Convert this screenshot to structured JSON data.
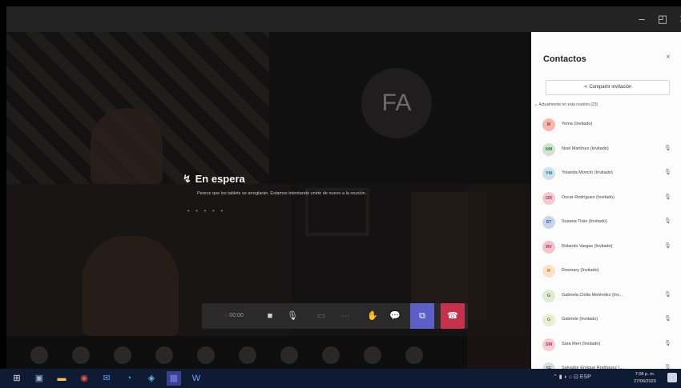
{
  "window": {
    "controls": {
      "minimize": "–",
      "restore": "◰",
      "close": "✕"
    }
  },
  "stage": {
    "avatar_initials": "FA",
    "waiting": {
      "title": "En espera",
      "icon": "waiting-icon",
      "message": "Parece que los tablets se arreglarán. Estamos intentando unirte de nuevo a la reunión.",
      "dots": "• • • • •"
    }
  },
  "controls": {
    "timer": "00:00",
    "buttons": [
      {
        "name": "camera-icon",
        "glyph": "■"
      },
      {
        "name": "microphone-icon",
        "glyph": "🎙"
      },
      {
        "name": "share-screen-icon",
        "glyph": "▭"
      },
      {
        "name": "more-options-icon",
        "glyph": "···"
      },
      {
        "name": "raise-hand-icon",
        "glyph": "✋"
      },
      {
        "name": "chat-icon",
        "glyph": "💬"
      },
      {
        "name": "participants-icon",
        "glyph": "⧉"
      },
      {
        "name": "hang-up-icon",
        "glyph": "☎"
      }
    ],
    "colors": {
      "participants": "#5b5fc7",
      "hang_up": "#c4314b"
    }
  },
  "panel": {
    "title": "Contactos",
    "close": "×",
    "invite_label": "Compartir invitación",
    "section_header": "Actualmente en esta reunión (23)",
    "contacts": [
      {
        "initials": "M",
        "name": "Yoma (Invitado)",
        "color": "#f4b8b0",
        "fg": "#b23f2c",
        "mic": false
      },
      {
        "initials": "NM",
        "name": "Noel Martínez (Invitado)",
        "color": "#cfe3cf",
        "fg": "#3d7a3d",
        "mic": true
      },
      {
        "initials": "YM",
        "name": "Yolanda Moncín (Invitado)",
        "color": "#cde3ec",
        "fg": "#2c6d86",
        "mic": true
      },
      {
        "initials": "OR",
        "name": "Oscar Rodríguez (Invitado)",
        "color": "#f3c9d6",
        "fg": "#a23a5e",
        "mic": true
      },
      {
        "initials": "ST",
        "name": "Susana Tirán (Invitado)",
        "color": "#c8d5ee",
        "fg": "#3b5794",
        "mic": true
      },
      {
        "initials": "RV",
        "name": "Rolando Vargas (Invitado)",
        "color": "#f5c2cf",
        "fg": "#a3324e",
        "mic": true
      },
      {
        "initials": "R",
        "name": "Rosmary (Invitado)",
        "color": "#fde2c4",
        "fg": "#b5702d",
        "mic": false
      },
      {
        "initials": "G",
        "name": "Gabriela Chilia Meléndez (Inv...",
        "color": "#dcebd3",
        "fg": "#4f7d38",
        "mic": true
      },
      {
        "initials": "G",
        "name": "Gabriele (Invitado)",
        "color": "#e7efd6",
        "fg": "#6b8336",
        "mic": true
      },
      {
        "initials": "SM",
        "name": "Sara Meri (Invitado)",
        "color": "#f6ccd3",
        "fg": "#a53b4f",
        "mic": true
      },
      {
        "initials": "SE",
        "name": "Salvador Enrique Rodríguez (...",
        "color": "#d8dfe3",
        "fg": "#4f616a",
        "mic": true
      }
    ]
  },
  "taskbar": {
    "items": [
      {
        "name": "start-icon",
        "glyph": "⊞",
        "color": "#e6ecf6"
      },
      {
        "name": "task-view-icon",
        "glyph": "▣",
        "color": "#9fb2d6"
      },
      {
        "name": "file-explorer-icon",
        "glyph": "▬",
        "color": "#f2c94c"
      },
      {
        "name": "chrome-icon",
        "glyph": "◉",
        "color": "#e8554a"
      },
      {
        "name": "mail-icon",
        "glyph": "✉",
        "color": "#4aa3ff"
      },
      {
        "name": "edge-icon",
        "glyph": "◔",
        "color": "#2fb7c7"
      },
      {
        "name": "photos-icon",
        "glyph": "◈",
        "color": "#59c1ef"
      },
      {
        "name": "teams-icon",
        "glyph": "▦",
        "color": "#7b83eb"
      },
      {
        "name": "word-icon",
        "glyph": "W",
        "color": "#6aa1ff"
      }
    ],
    "tray": "⌃  ▮  ◗  ⌂  ⊡  ESP",
    "clock_time": "7:08 p. m.",
    "clock_date": "27/06/2020"
  }
}
